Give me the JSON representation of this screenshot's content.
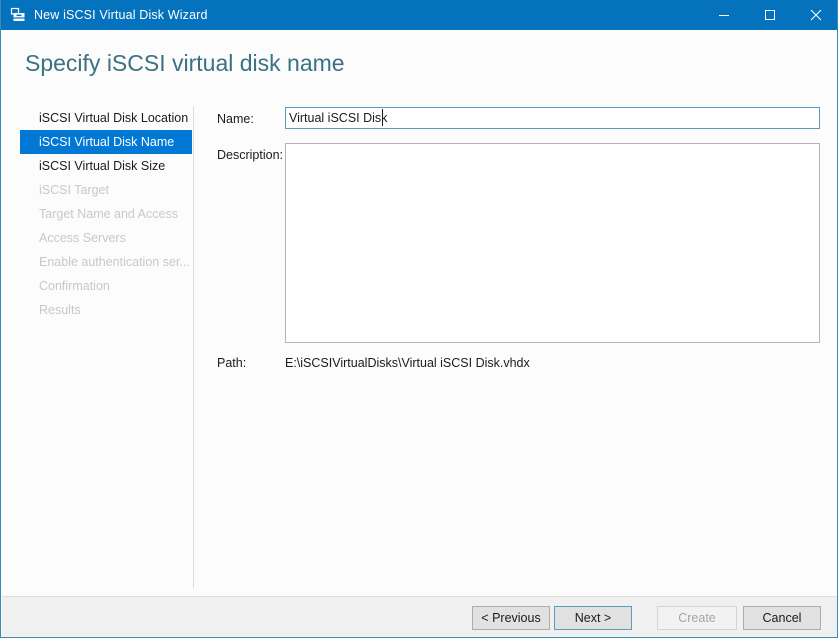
{
  "window": {
    "title": "New iSCSI Virtual Disk Wizard",
    "icon": "disk-wizard-icon",
    "accent_color": "#0572bd",
    "controls": {
      "minimize": "minimize-icon",
      "maximize": "maximize-icon",
      "close": "close-icon"
    }
  },
  "header": {
    "page_title": "Specify iSCSI virtual disk name",
    "title_color": "#3b7282"
  },
  "sidebar": {
    "selected_index": 1,
    "selected_color": "#0078d4",
    "items": [
      {
        "label": "iSCSI Virtual Disk Location",
        "state": "enabled"
      },
      {
        "label": "iSCSI Virtual Disk Name",
        "state": "selected"
      },
      {
        "label": "iSCSI Virtual Disk Size",
        "state": "enabled"
      },
      {
        "label": "iSCSI Target",
        "state": "disabled"
      },
      {
        "label": "Target Name and Access",
        "state": "disabled"
      },
      {
        "label": "Access Servers",
        "state": "disabled"
      },
      {
        "label": "Enable authentication ser...",
        "state": "disabled"
      },
      {
        "label": "Confirmation",
        "state": "disabled"
      },
      {
        "label": "Results",
        "state": "disabled"
      }
    ]
  },
  "form": {
    "name": {
      "label": "Name:",
      "value": "Virtual iSCSI Disk",
      "placeholder": ""
    },
    "description": {
      "label": "Description:",
      "value": "",
      "placeholder": ""
    },
    "path": {
      "label": "Path:",
      "value": "E:\\iSCSIVirtualDisks\\Virtual iSCSI Disk.vhdx"
    }
  },
  "footer": {
    "buttons": [
      {
        "label": "< Previous",
        "state": "enabled"
      },
      {
        "label": "Next >",
        "state": "default"
      },
      {
        "label": "Create",
        "state": "disabled"
      },
      {
        "label": "Cancel",
        "state": "enabled"
      }
    ]
  }
}
